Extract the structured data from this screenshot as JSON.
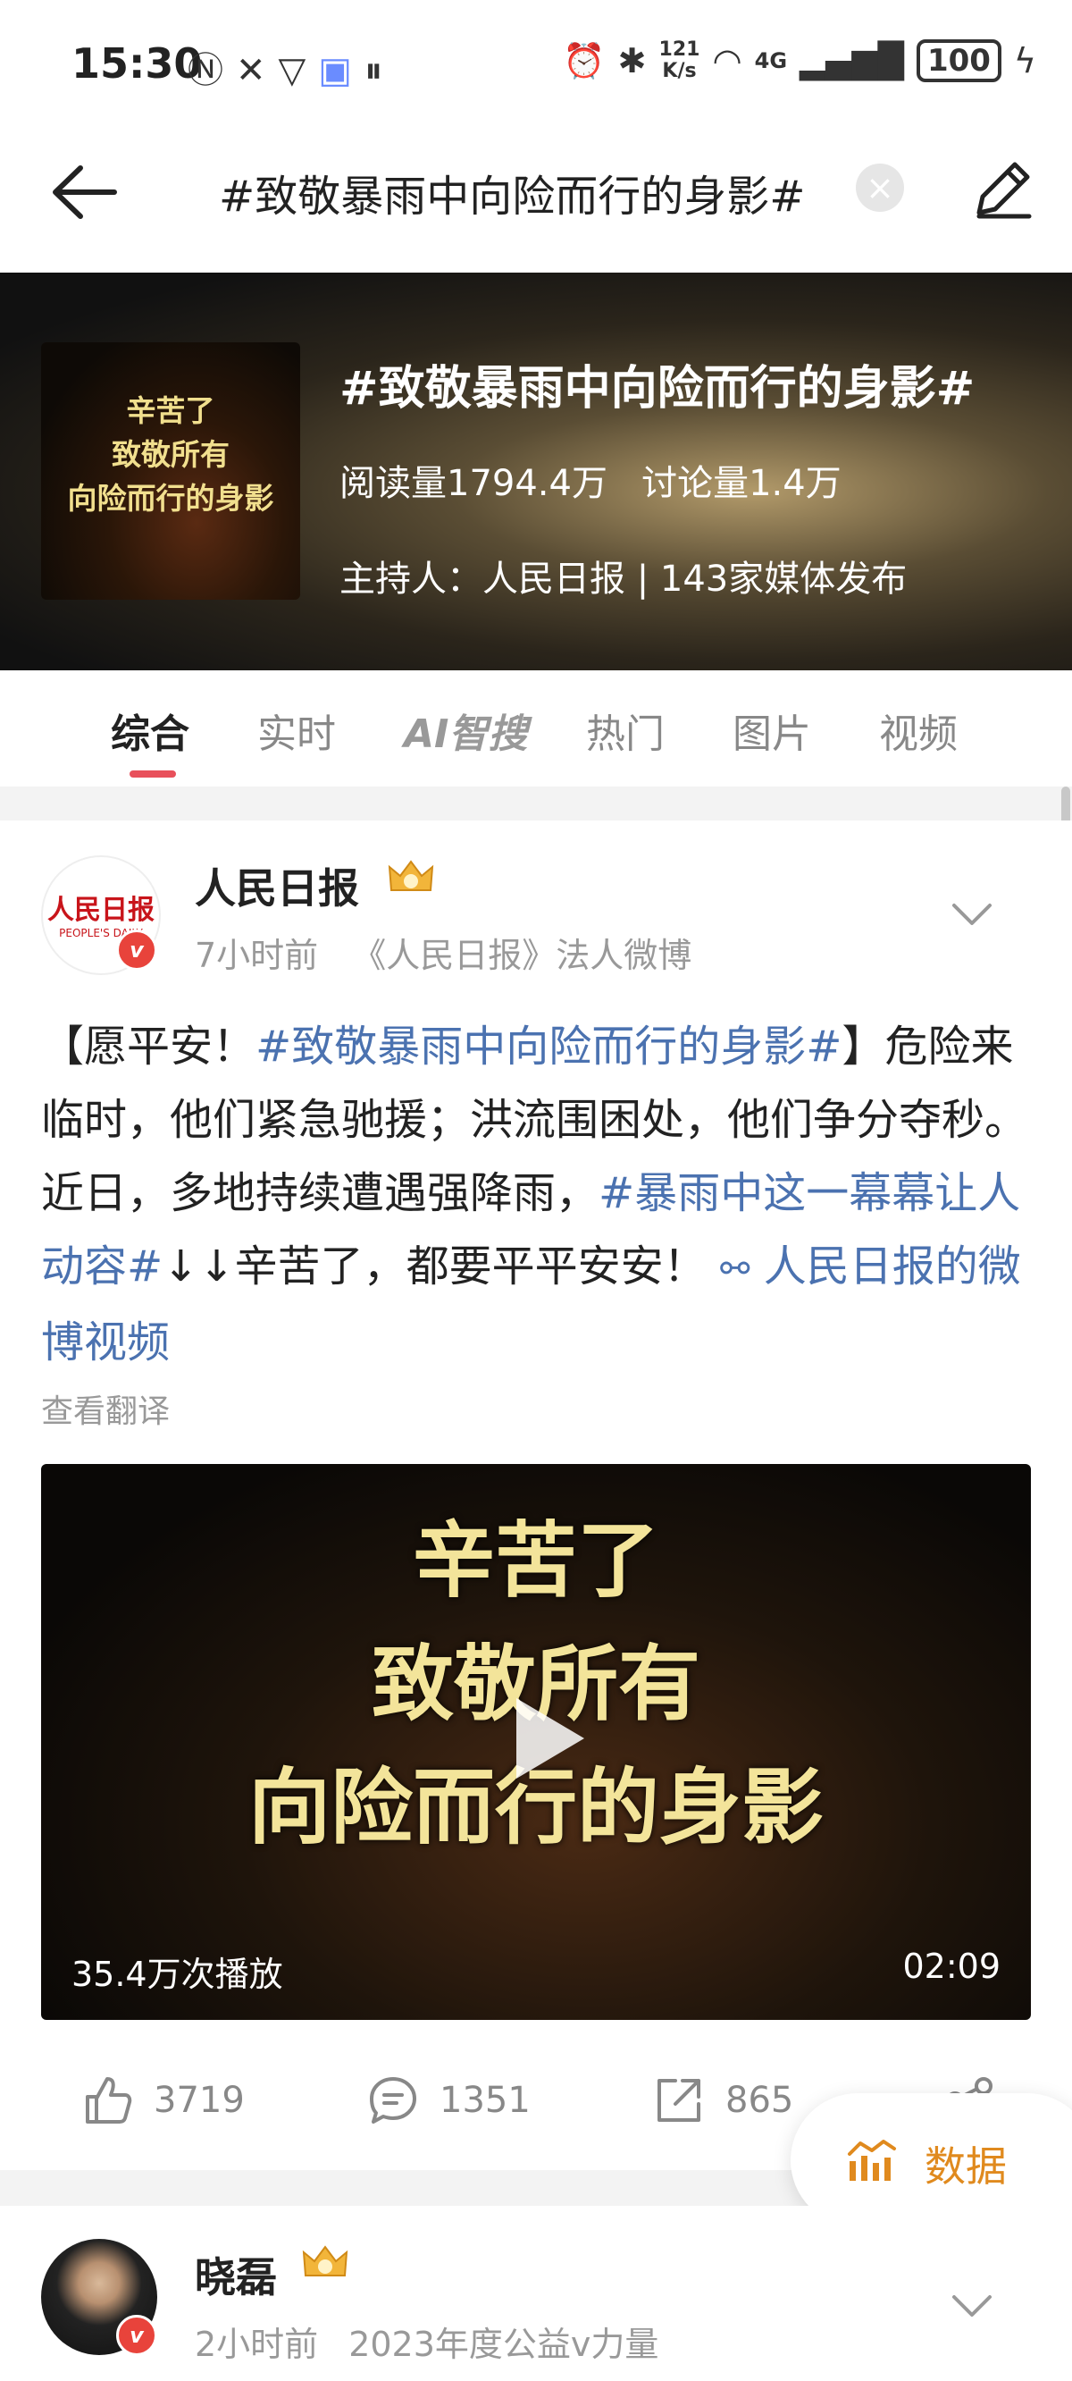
{
  "status_bar": {
    "time": "15:30",
    "net_speed_value": "121",
    "net_speed_unit": "K/s",
    "network": "4G",
    "battery": "100"
  },
  "search": {
    "query": "#致敬暴雨中向险而行的身影#"
  },
  "topic": {
    "title": "#致敬暴雨中向险而行的身影#",
    "thumb_lines": [
      "辛苦了",
      "致敬所有",
      "向险而行的身影"
    ],
    "stats": "阅读量1794.4万   讨论量1.4万",
    "host": "主持人：人民日报 | 143家媒体发布"
  },
  "tabs": [
    {
      "label": "综合"
    },
    {
      "label": "实时"
    },
    {
      "label": "AI智搜"
    },
    {
      "label": "热门"
    },
    {
      "label": "图片"
    },
    {
      "label": "视频"
    }
  ],
  "post1": {
    "username": "人民日报",
    "avatar_logo": "人民日报",
    "avatar_logo_sub": "PEOPLE'S DAILY",
    "time": "7小时前",
    "source": "《人民日报》法人微博",
    "body": {
      "prefix": "【愿平安！",
      "hashtag1": "#致敬暴雨中向险而行的身影#",
      "text1": "】危险来临时，他们紧急驰援；洪流围困处，他们争分夺秒。近日，多地持续遭遇强降雨，",
      "hashtag2": "#暴雨中这一幕幕让人动容#",
      "text2": "↓↓辛苦了，都要平平安安！",
      "link": "人民日报的微博视频"
    },
    "translate": "查看翻译",
    "video": {
      "lines": [
        "辛苦了",
        "致敬所有",
        "向险而行的身影"
      ],
      "plays": "35.4万次播放",
      "duration": "02:09"
    },
    "likes": "3719",
    "comments": "1351",
    "reposts": "865"
  },
  "floating_button": {
    "label": "数据"
  },
  "post2": {
    "username": "晓磊",
    "time": "2小时前",
    "source": "2023年度公益v力量"
  },
  "colors": {
    "accent": "#e8505b",
    "link": "#4b72b0",
    "data_button": "#e08a1e"
  }
}
